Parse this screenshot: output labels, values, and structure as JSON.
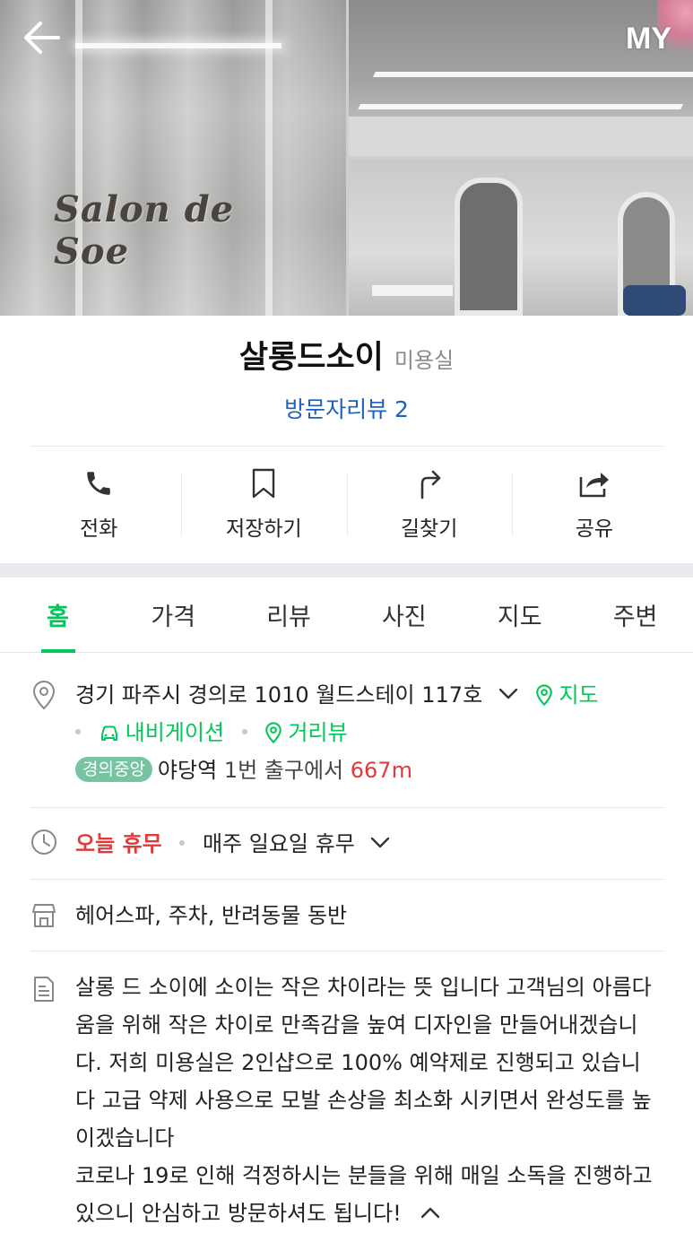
{
  "hero": {
    "logo_text": "Salon de Soe",
    "my_label": "MY"
  },
  "place": {
    "name": "살롱드소이",
    "category": "미용실",
    "visitor_reviews": "방문자리뷰 2"
  },
  "actions": [
    {
      "label": "전화",
      "icon": "phone-icon"
    },
    {
      "label": "저장하기",
      "icon": "bookmark-icon"
    },
    {
      "label": "길찾기",
      "icon": "directions-icon"
    },
    {
      "label": "공유",
      "icon": "share-icon"
    }
  ],
  "tabs": [
    {
      "label": "홈",
      "active": true
    },
    {
      "label": "가격"
    },
    {
      "label": "리뷰"
    },
    {
      "label": "사진"
    },
    {
      "label": "지도"
    },
    {
      "label": "주변"
    }
  ],
  "address": {
    "text": "경기 파주시 경의로 1010 월드스테이 117호",
    "map_link": "지도",
    "navigation_link": "내비게이션",
    "street_view_link": "거리뷰",
    "subway_line": "경의중앙",
    "station": "야당역",
    "exit_text": "1번 출구에서",
    "distance": "667m"
  },
  "hours": {
    "status": "오늘 휴무",
    "detail": "매주 일요일 휴무"
  },
  "amenities": "헤어스파, 주차, 반려동물 동반",
  "description": {
    "paragraph1": "살롱 드 소이에 소이는 작은 차이라는 뜻 입니다 고객님의 아름다움을 위해 작은 차이로 만족감을 높여 디자인을 만들어내겠습니다. 저희 미용실은 2인샵으로 100% 예약제로 진행되고 있습니다 고급 약제 사용으로 모발 손상을 최소화 시키면서 완성도를 높이겠습니다",
    "paragraph2": "코로나 19로 인해 걱정하시는 분들을 위해 매일 소독을 진행하고 있으니 안심하고 방문하셔도 됩니다!"
  },
  "colors": {
    "accent_green": "#03c75a",
    "link_blue": "#1d62b8",
    "closed_red": "#e03b3b",
    "line_badge": "#77c4a3"
  }
}
